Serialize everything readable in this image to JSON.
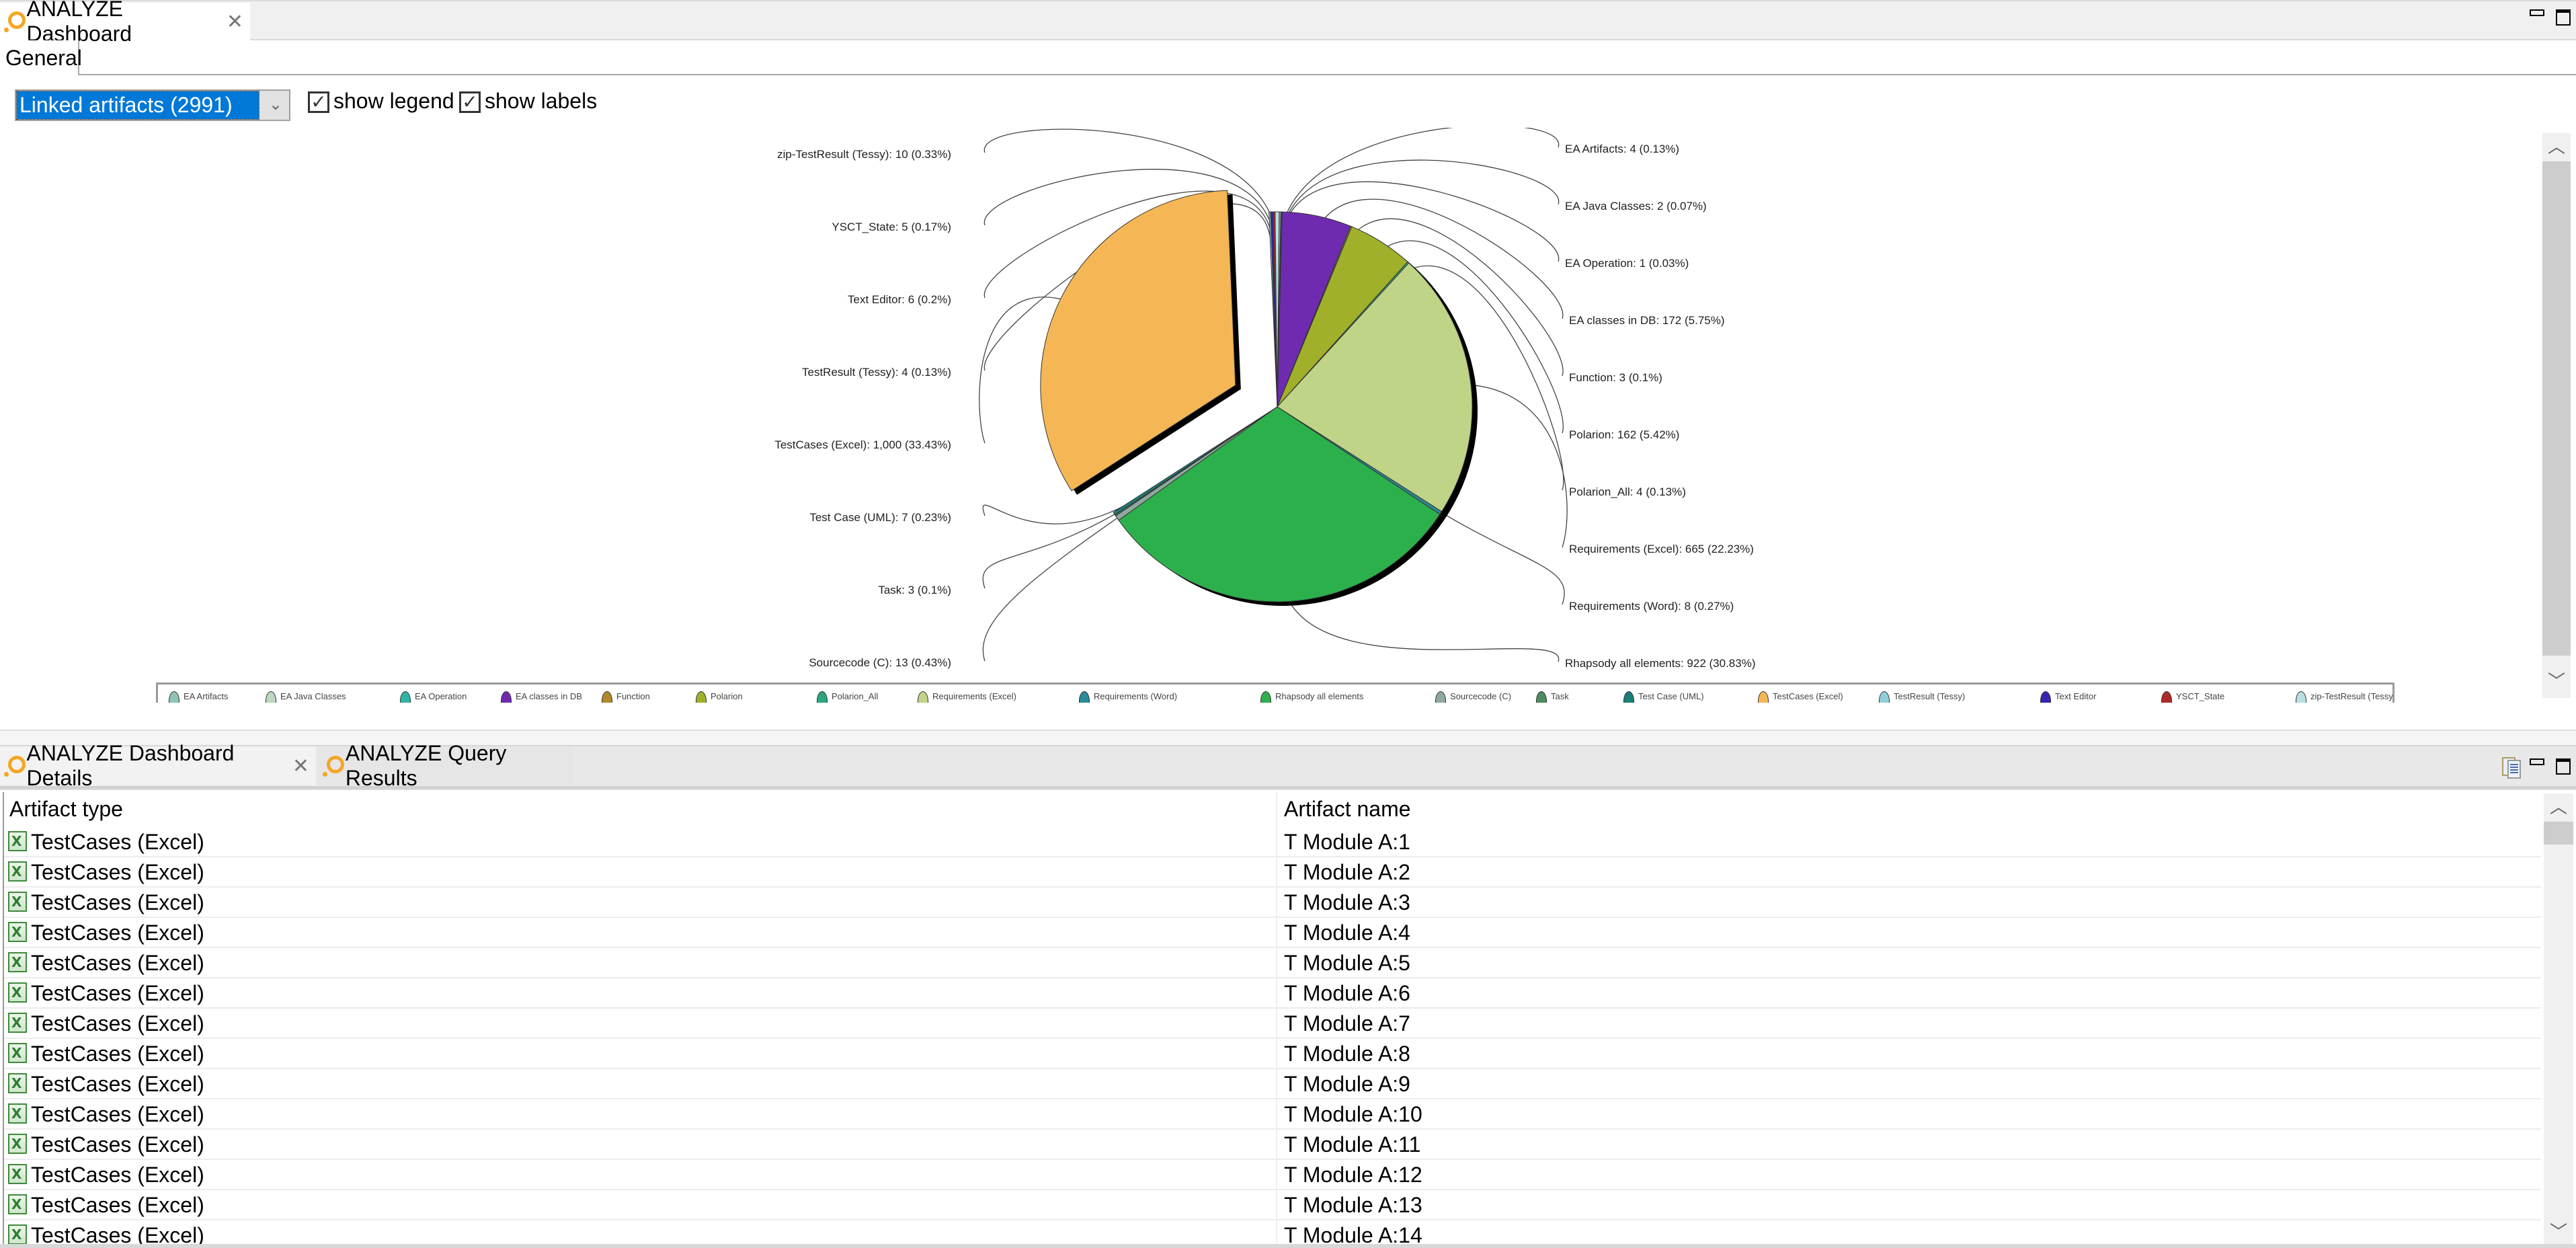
{
  "top_view": {
    "tab_label": "ANALYZE Dashboard",
    "sub_tab_label": "General",
    "window_controls": [
      "minimize-icon",
      "maximize-icon"
    ]
  },
  "controls": {
    "selector_value": "Linked artifacts (2991)",
    "show_legend_label": "show legend",
    "show_legend_checked": true,
    "show_labels_label": "show labels",
    "show_labels_checked": true
  },
  "chart_data": {
    "type": "pie",
    "title": "Linked artifacts (2991)",
    "total": 2991,
    "exploded_slice": "TestCases (Excel)",
    "legend_placement": "bottom",
    "slices": [
      {
        "name": "EA Artifacts",
        "value": 4,
        "percent": "0.13%",
        "label": "EA Artifacts: 4 (0.13%)",
        "color": "#8fc3b8"
      },
      {
        "name": "EA Java Classes",
        "value": 2,
        "percent": "0.07%",
        "label": "EA Java Classes: 2 (0.07%)",
        "color": "#bcd8c0"
      },
      {
        "name": "EA Operation",
        "value": 1,
        "percent": "0.03%",
        "label": "EA Operation: 1 (0.03%)",
        "color": "#2fb5a5"
      },
      {
        "name": "EA classes in DB",
        "value": 172,
        "percent": "5.75%",
        "label": "EA classes in DB: 172 (5.75%)",
        "color": "#6e2bb0"
      },
      {
        "name": "Function",
        "value": 3,
        "percent": "0.1%",
        "label": "Function: 3 (0.1%)",
        "color": "#b08a2a"
      },
      {
        "name": "Polarion",
        "value": 162,
        "percent": "5.42%",
        "label": "Polarion: 162 (5.42%)",
        "color": "#a0b02a"
      },
      {
        "name": "Polarion_All",
        "value": 4,
        "percent": "0.13%",
        "label": "Polarion_All: 4 (0.13%)",
        "color": "#2aa77a"
      },
      {
        "name": "Requirements (Excel)",
        "value": 665,
        "percent": "22.23%",
        "label": "Requirements (Excel): 665 (22.23%)",
        "color": "#bfd486"
      },
      {
        "name": "Requirements (Word)",
        "value": 8,
        "percent": "0.27%",
        "label": "Requirements (Word): 8 (0.27%)",
        "color": "#2b8a98"
      },
      {
        "name": "Rhapsody all elements",
        "value": 922,
        "percent": "30.83%",
        "label": "Rhapsody all elements: 922 (30.83%)",
        "color": "#2cb04c"
      },
      {
        "name": "Sourcecode (C)",
        "value": 13,
        "percent": "0.43%",
        "label": "Sourcecode (C): 13 (0.43%)",
        "color": "#8fa8a0"
      },
      {
        "name": "Task",
        "value": 3,
        "percent": "0.1%",
        "label": "Task: 3 (0.1%)",
        "color": "#4f8a60"
      },
      {
        "name": "Test Case (UML)",
        "value": 7,
        "percent": "0.23%",
        "label": "Test Case (UML): 7 (0.23%)",
        "color": "#1a7f78"
      },
      {
        "name": "TestCases (Excel)",
        "value": 1000,
        "percent": "33.43%",
        "label": "TestCases (Excel): 1,000 (33.43%)",
        "color": "#f5b755"
      },
      {
        "name": "TestResult (Tessy)",
        "value": 4,
        "percent": "0.13%",
        "label": "TestResult (Tessy): 4 (0.13%)",
        "color": "#8fd0d8"
      },
      {
        "name": "Text Editor",
        "value": 6,
        "percent": "0.2%",
        "label": "Text Editor: 6 (0.2%)",
        "color": "#3425b0"
      },
      {
        "name": "YSCT_State",
        "value": 5,
        "percent": "0.17%",
        "label": "YSCT_State: 5 (0.17%)",
        "color": "#b02a2a"
      },
      {
        "name": "zip-TestResult (Tessy)",
        "value": 10,
        "percent": "0.33%",
        "label": "zip-TestResult (Tessy): 10 (0.33%)",
        "color": "#b8e0e4"
      }
    ],
    "left_labels": [
      "zip-TestResult (Tessy)",
      "YSCT_State",
      "Text Editor",
      "TestResult (Tessy)",
      "TestCases (Excel)",
      "Test Case (UML)",
      "Task",
      "Sourcecode (C)"
    ],
    "right_labels": [
      "EA Artifacts",
      "EA Java Classes",
      "EA Operation",
      "EA classes in DB",
      "Function",
      "Polarion",
      "Polarion_All",
      "Requirements (Excel)",
      "Requirements (Word)",
      "Rhapsody all elements"
    ]
  },
  "bottom_view": {
    "tabs": [
      {
        "label": "ANALYZE Dashboard Details",
        "active": true,
        "closable": true
      },
      {
        "label": "ANALYZE Query Results",
        "active": false,
        "closable": false
      }
    ],
    "toolbar_icons": [
      "copy-document-icon",
      "minimize-icon",
      "maximize-icon"
    ],
    "table": {
      "columns": [
        "Artifact type",
        "Artifact name"
      ],
      "rows": [
        [
          "TestCases (Excel)",
          "T Module A:1"
        ],
        [
          "TestCases (Excel)",
          "T Module A:2"
        ],
        [
          "TestCases (Excel)",
          "T Module A:3"
        ],
        [
          "TestCases (Excel)",
          "T Module A:4"
        ],
        [
          "TestCases (Excel)",
          "T Module A:5"
        ],
        [
          "TestCases (Excel)",
          "T Module A:6"
        ],
        [
          "TestCases (Excel)",
          "T Module A:7"
        ],
        [
          "TestCases (Excel)",
          "T Module A:8"
        ],
        [
          "TestCases (Excel)",
          "T Module A:9"
        ],
        [
          "TestCases (Excel)",
          "T Module A:10"
        ],
        [
          "TestCases (Excel)",
          "T Module A:11"
        ],
        [
          "TestCases (Excel)",
          "T Module A:12"
        ],
        [
          "TestCases (Excel)",
          "T Module A:13"
        ],
        [
          "TestCases (Excel)",
          "T Module A:14"
        ]
      ]
    }
  }
}
